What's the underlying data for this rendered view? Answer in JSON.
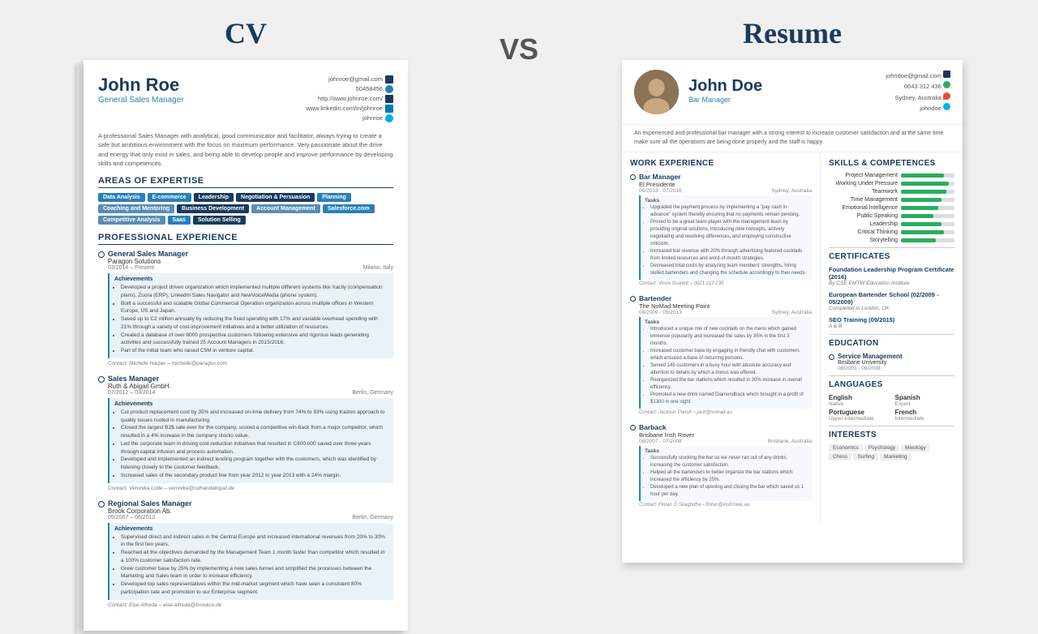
{
  "header": {
    "cv_label": "CV",
    "vs_label": "VS",
    "resume_label": "Resume"
  },
  "cv": {
    "name": "John Roe",
    "title": "General Sales Manager",
    "contact": {
      "email": "johnroe@gmail.com",
      "phone": "50458456",
      "website": "http://www.johnroe.com/",
      "linkedin": "www.linkedin.com/in/johnroe",
      "skype": "johnroe"
    },
    "summary": "A professional Sales Manager with analytical, good communicator and facilitator, always trying to create a safe but ambitious environment with the focus on maximum performance. Very passionate about the drive and energy that only exist in sales, and being able to develop people and improve performance by developing skills and competences.",
    "areas_of_expertise": {
      "title": "AREAS OF EXPERTISE",
      "tags": [
        {
          "label": "Data Analysis",
          "color": "blue"
        },
        {
          "label": "E-commerce",
          "color": "blue"
        },
        {
          "label": "Leadership",
          "color": "dark"
        },
        {
          "label": "Negotiation & Persuasion",
          "color": "dark"
        },
        {
          "label": "Planning",
          "color": "blue"
        },
        {
          "label": "Coaching and Mentoring",
          "color": "light"
        },
        {
          "label": "Business Development",
          "color": "dark"
        },
        {
          "label": "Account Management",
          "color": "light"
        },
        {
          "label": "Salesforce.com",
          "color": "blue"
        },
        {
          "label": "Competitive Analysis",
          "color": "light"
        },
        {
          "label": "Saas",
          "color": "blue"
        },
        {
          "label": "Solution Selling",
          "color": "dark"
        }
      ]
    },
    "professional_experience": {
      "title": "PROFESSIONAL EXPERIENCE",
      "jobs": [
        {
          "title": "General Sales Manager",
          "company": "Paragon Solutions",
          "date": "03/2014 – Present",
          "location": "Milano, Italy",
          "achievements": [
            "Developed a project driven organization which implemented multiple different systems like Xactly (compensation plans), Zuora (ERP), LinkedIn Sales Navigator and NewVoiceMedia (phone system).",
            "Built a successful and scalable Global Commercial Operation organization across multiple offices in Western Europe, US and Japan.",
            "Saved up to C2 million annually by reducing the fixed spending with 17% and variable overhead spending with 21% through a variety of cost-improvement initiatives and a better utilization of resources.",
            "Created a database of over 8000 prospective customers following extensive and rigorous leads generating activities and successfully trained 25 Account Managers in 2015/2016.",
            "Part of the initial team who raised C5M in venture capital."
          ],
          "contact": "Contact: Michelle Harper – michelle@paragon.com"
        },
        {
          "title": "Sales Manager",
          "company": "Ruth & Abigail GmbH.",
          "date": "07/2012 – 03/2014",
          "location": "Berlin, Germany",
          "achievements": [
            "Cut product replacement cost by 35% and increased on-time delivery from 74% to 93% using Kaizen approach to quality issues rooted in manufacturing.",
            "Closed the largest B2$ sale ever for the company, scored a competitive win-back from a major competitor, which resulted in a 4% increase in the company stocks value.",
            "Led the corporate team in driving cost-reduction initiatives that resulted in C800.000 saved over three years through capital infusion and process automation.",
            "Developed and implemented an indirect lending program together with the customers, which was identified by listening closely to the customer feedback.",
            "Increased sales of the secondary product line from year 2012 to year 2013 with a 24% margin."
          ],
          "contact": "Contact: Veronika Lotte – veronika@ruthandabigail.de"
        },
        {
          "title": "Regional Sales Manager",
          "company": "Brook Corporation Ab.",
          "date": "05/2007 – 06/2012",
          "location": "Berlin, Germany",
          "achievements": [
            "Supervised direct and indirect sales in the Central Europe and increased international revenues from 20% to 30% in the first two years.",
            "Reached all the objectives demanded by the Management Team 1 month faster than competitor which resulted in a 100% customer satisfaction rate.",
            "Grew customer base by 25% by implementing a new sales funnel and simplified the processes between the Marketing and Sales team in order to increase efficiency.",
            "Developed top sales representatives within the mid-market segment which have seen a consistent 80% participation rate and promotion to our Enterprise segment."
          ],
          "contact": "Contact: Else Alfreda – else.alfreda@brookco.de"
        }
      ]
    }
  },
  "resume": {
    "name": "John Doe",
    "title": "Bar Manager",
    "contact": {
      "email": "johndoe@gmail.com",
      "phone": "0043 312 436",
      "location": "Sydney, Australia",
      "skype": "johndoe"
    },
    "summary": "An experienced and professional bar manager with a strong interest to increase customer satisfaction and at the same time make sure all the operations are being done properly and the staff is happy.",
    "work_experience": {
      "title": "WORK EXPERIENCE",
      "jobs": [
        {
          "title": "Bar Manager",
          "company": "El Presidente",
          "date": "06/2013 - 07/2016",
          "location": "Sydney, Australia",
          "tasks": [
            "Upgraded the payment process by implementing a 'pay cash in advance' system thereby ensuring that no payments remain pending.",
            "Proved to be a great team-player with the management team by providing original solutions, introducing new concepts, actively negotiating and resolving differences, and employing constructive criticism.",
            "Increased bar revenue with 20% through advertising featured cocktails from limited resources and word-of-mouth strategies.",
            "Decreased total costs by analyzing team members' strengths, hiring skilled bartenders and changing the schedule accordingly to their needs."
          ],
          "contact": "Contact: Vince Scarlett – 0021 213 235"
        },
        {
          "title": "Bartender",
          "company": "The NoMad Meeting Point",
          "date": "08/2009 - 05/2013",
          "location": "Sydney, Australia",
          "tasks": [
            "Introduced a unique mix of new cocktails on the menu which gained immense popularity and increased the sales by 35% in the first 3 months.",
            "Increased customer base by engaging in friendly chat with customers which ensured a base of recurring persons.",
            "Served 145 customers in a busy hour with absolute accuracy and attention to details by which a bonus was offered.",
            "Reorganized the bar stations which resulted in 30% increase in overall efficiency.",
            "Promoted a new drink named Diamondback which brought in a profit of $1300 in one night."
          ],
          "contact": "Contact: Jackson Parish – jack@nomad.au"
        },
        {
          "title": "Barback",
          "company": "Brisbane Irish Rover",
          "date": "08/2007 - 07/2008",
          "location": "Brisbane, Australia",
          "tasks": [
            "Successfully stocking the bar so we never ran out of any drinks, increasing the customer satisfaction.",
            "Helped all the bartenders to better organize the bar stations which increased the efficiency by 25%.",
            "Developed a new plan of opening and closing the bar which saved us 1 hour per day."
          ],
          "contact": "Contact: Fintan Ó Séaghdha – fintan@irishrover.au"
        }
      ]
    },
    "skills": {
      "title": "SKILLS & COMPETENCES",
      "items": [
        {
          "name": "Project Management",
          "pct": 80
        },
        {
          "name": "Working Under Pressure",
          "pct": 90
        },
        {
          "name": "Teamwork",
          "pct": 85
        },
        {
          "name": "Time Management",
          "pct": 75
        },
        {
          "name": "Emotional Intelligence",
          "pct": 70
        },
        {
          "name": "Public Speaking",
          "pct": 60
        },
        {
          "name": "Leadership",
          "pct": 75
        },
        {
          "name": "Critical Thinking",
          "pct": 80
        },
        {
          "name": "Storytelling",
          "pct": 65
        }
      ]
    },
    "certificates": {
      "title": "CERTIFICATES",
      "items": [
        {
          "name": "Foundation Leadership Program Certificate (2016)",
          "org": "By CSE EMTW Education Institute"
        },
        {
          "name": "European Bartender School (02/2009 - 05/2009)",
          "org": "Completed in London, UK"
        },
        {
          "name": "SEO Training (09/2015)",
          "org": "A & B"
        }
      ]
    },
    "education": {
      "title": "EDUCATION",
      "items": [
        {
          "degree": "Service Management",
          "school": "Brisbane University",
          "date": "08/2003 - 06/2008"
        }
      ]
    },
    "languages": {
      "title": "LANGUAGES",
      "items": [
        {
          "name": "English",
          "level": "Native"
        },
        {
          "name": "Spanish",
          "level": "Expert"
        },
        {
          "name": "Portuguese",
          "level": "Upper-intermediate"
        },
        {
          "name": "French",
          "level": "Intermediate"
        }
      ]
    },
    "interests": {
      "title": "INTERESTS",
      "tags": [
        "Economics",
        "Psychology",
        "Mixology",
        "Chess",
        "Surfing",
        "Marketing"
      ]
    }
  }
}
